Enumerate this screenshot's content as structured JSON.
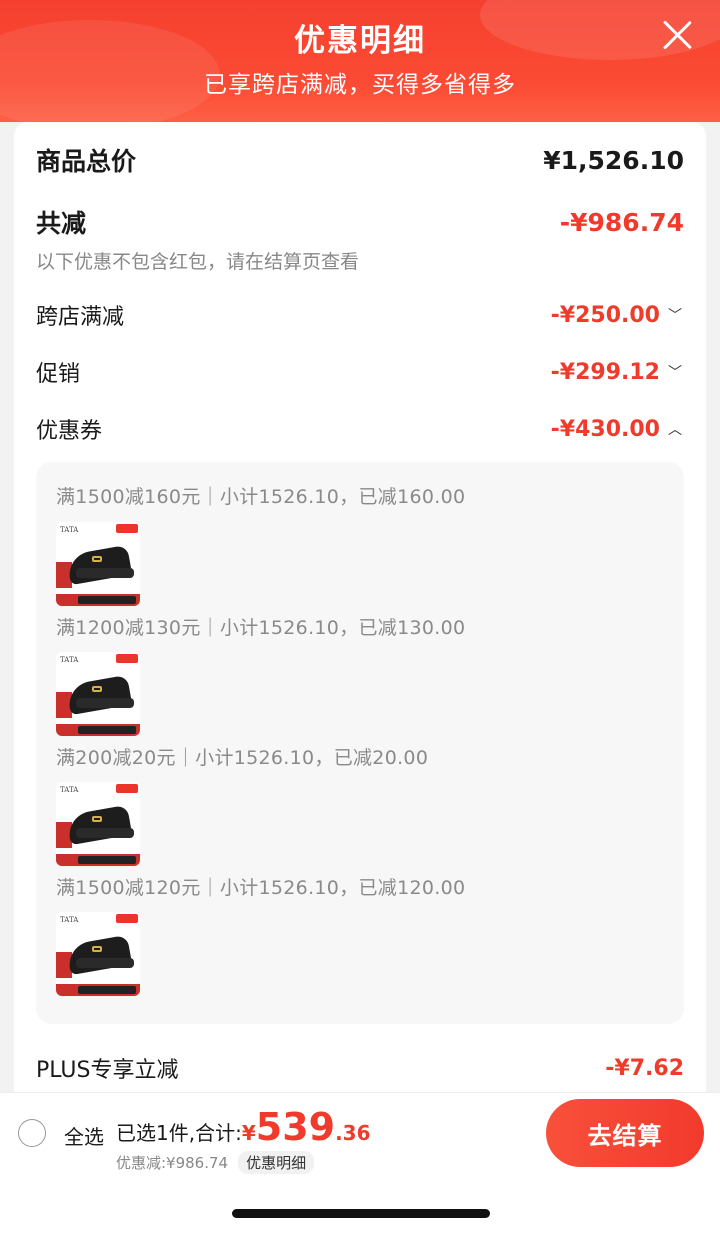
{
  "header": {
    "title": "优惠明细",
    "subtitle": "已享跨店满减，买得多省得多"
  },
  "summary": {
    "total_label": "商品总价",
    "total_value": "¥1,526.10",
    "discount_label": "共减",
    "discount_value": "-¥986.74",
    "hint": "以下优惠不包含红包，请在结算页查看"
  },
  "items": [
    {
      "label": "跨店满减",
      "value": "-¥250.00",
      "chevron": "chevron-down-icon"
    },
    {
      "label": "促销",
      "value": "-¥299.12",
      "chevron": "chevron-down-icon"
    },
    {
      "label": "优惠券",
      "value": "-¥430.00",
      "chevron": "chevron-up-icon"
    }
  ],
  "coupons": [
    {
      "rule": "满1500减160元｜小计1526.10，已减160.00"
    },
    {
      "rule": "满1200减130元｜小计1526.10，已减130.00"
    },
    {
      "rule": "满200减20元｜小计1526.10，已减20.00"
    },
    {
      "rule": "满1500减120元｜小计1526.10，已减120.00"
    }
  ],
  "product_thumb": {
    "brand": "TATA",
    "icon": "shoe-thumbnail"
  },
  "plus": {
    "label": "PLUS专享立减",
    "value": "-¥7.62"
  },
  "footer": {
    "select_all": "全选",
    "selected_text": "已选1件,合计:",
    "currency": "¥",
    "amount_int": "539",
    "amount_dec": ".36",
    "discount_text": "优惠减:¥986.74",
    "detail_label": "优惠明细",
    "checkout_label": "去结算"
  },
  "colors": {
    "accent_red": "#f03a2b",
    "header_red": "#f5402f"
  }
}
